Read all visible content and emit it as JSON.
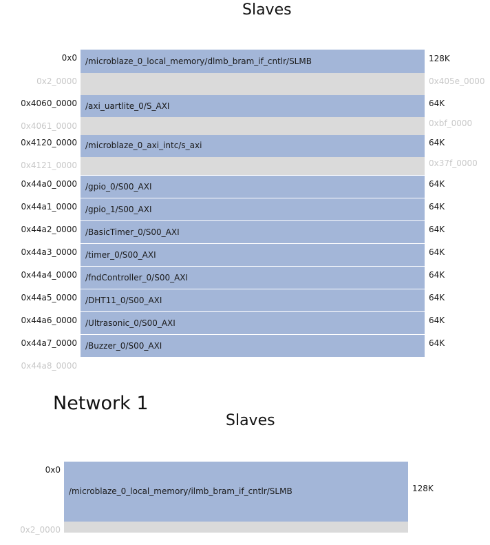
{
  "sections": [
    {
      "title": "Slaves",
      "rows": [
        {
          "addr": "0x0",
          "label": "/microblaze_0_local_memory/dlmb_bram_if_cntlr/SLMB",
          "size": "128K",
          "used": true
        },
        {
          "addr": "0x2_0000",
          "label": "",
          "size": "0x405e_0000",
          "used": false
        },
        {
          "addr": "0x4060_0000",
          "label": "/axi_uartlite_0/S_AXI",
          "size": "64K",
          "used": true
        },
        {
          "addr": "0x4061_0000",
          "label": "",
          "size": "0xbf_0000",
          "used": false
        },
        {
          "addr": "0x4120_0000",
          "label": "/microblaze_0_axi_intc/s_axi",
          "size": "64K",
          "used": true
        },
        {
          "addr": "0x4121_0000",
          "label": "",
          "size": "0x37f_0000",
          "used": false
        },
        {
          "addr": "0x44a0_0000",
          "label": "/gpio_0/S00_AXI",
          "size": "64K",
          "used": true
        },
        {
          "addr": "0x44a1_0000",
          "label": "/gpio_1/S00_AXI",
          "size": "64K",
          "used": true
        },
        {
          "addr": "0x44a2_0000",
          "label": "/BasicTimer_0/S00_AXI",
          "size": "64K",
          "used": true
        },
        {
          "addr": "0x44a3_0000",
          "label": "/timer_0/S00_AXI",
          "size": "64K",
          "used": true
        },
        {
          "addr": "0x44a4_0000",
          "label": "/fndController_0/S00_AXI",
          "size": "64K",
          "used": true
        },
        {
          "addr": "0x44a5_0000",
          "label": "/DHT11_0/S00_AXI",
          "size": "64K",
          "used": true
        },
        {
          "addr": "0x44a6_0000",
          "label": "/Ultrasonic_0/S00_AXI",
          "size": "64K",
          "used": true
        },
        {
          "addr": "0x44a7_0000",
          "label": "/Buzzer_0/S00_AXI",
          "size": "64K",
          "used": true
        }
      ],
      "end_addr": "0x44a8_0000"
    },
    {
      "network_title": "Network 1",
      "title": "Slaves",
      "rows": [
        {
          "addr": "0x0",
          "label": "/microblaze_0_local_memory/ilmb_bram_if_cntlr/SLMB",
          "size": "128K",
          "used": true
        },
        {
          "addr": "0x2_0000",
          "label": "",
          "size": "",
          "used": false
        }
      ]
    }
  ],
  "colors": {
    "used": "#a3b6d8",
    "free": "#dadada",
    "dim_text": "#c8c8c8"
  }
}
